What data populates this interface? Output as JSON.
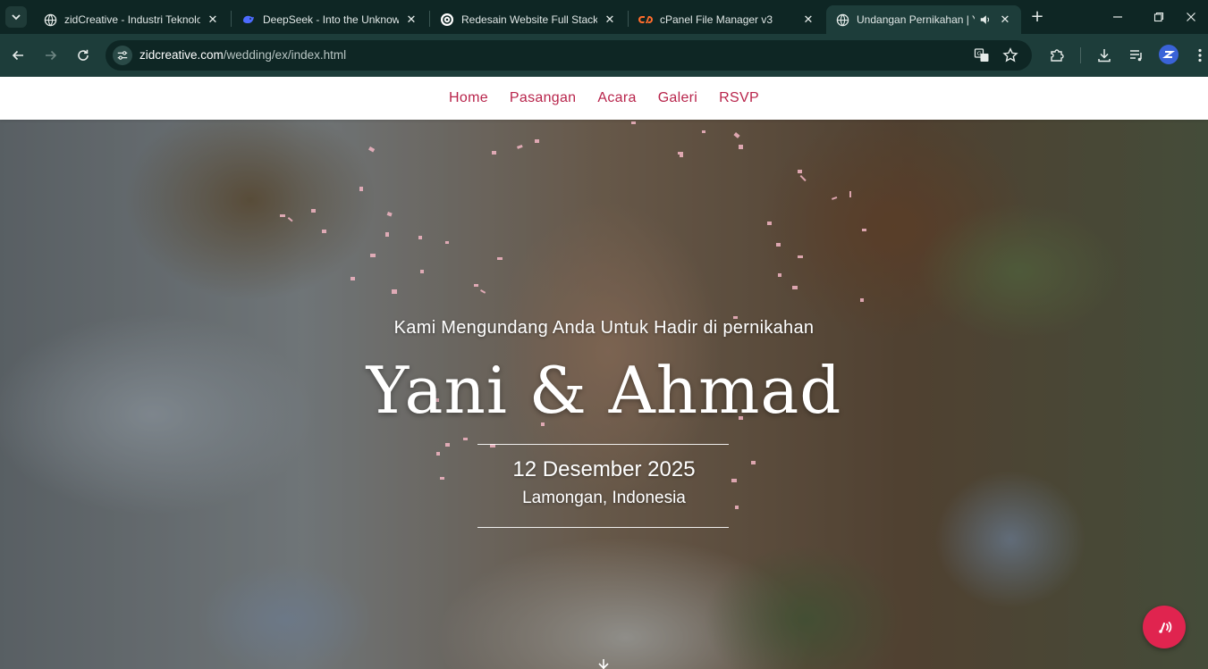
{
  "browser": {
    "tabs": [
      {
        "title": "zidCreative - Industri Teknologi",
        "favicon": "globe-icon",
        "active": false
      },
      {
        "title": "DeepSeek - Into the Unknown",
        "favicon": "deepseek-whale-icon",
        "active": false
      },
      {
        "title": "Redesain Website Full Stack",
        "favicon": "chatgpt-icon",
        "active": false
      },
      {
        "title": "cPanel File Manager v3",
        "favicon": "cpanel-icon",
        "active": false
      },
      {
        "title": "Undangan Pernikahan | Yani & Ahmad",
        "favicon": "globe-icon",
        "active": true,
        "audio": true
      }
    ],
    "url": {
      "host": "zidcreative.com",
      "path": "/wedding/ex/index.html"
    },
    "colors": {
      "frame": "#0e2624",
      "toolbar": "#1d3d3a"
    }
  },
  "site": {
    "nav": [
      "Home",
      "Pasangan",
      "Acara",
      "Galeri",
      "RSVP"
    ],
    "hero": {
      "invite_line": "Kami Mengundang Anda Untuk Hadir di pernikahan",
      "couple_names": "Yani & Ahmad",
      "date": "12 Desember 2025",
      "location": "Lamongan, Indonesia"
    },
    "music_button_icon": "music-sound-icon",
    "colors": {
      "nav_text": "#b8244b",
      "accent": "#e0244f",
      "confetti": "#f4b6c4"
    }
  }
}
